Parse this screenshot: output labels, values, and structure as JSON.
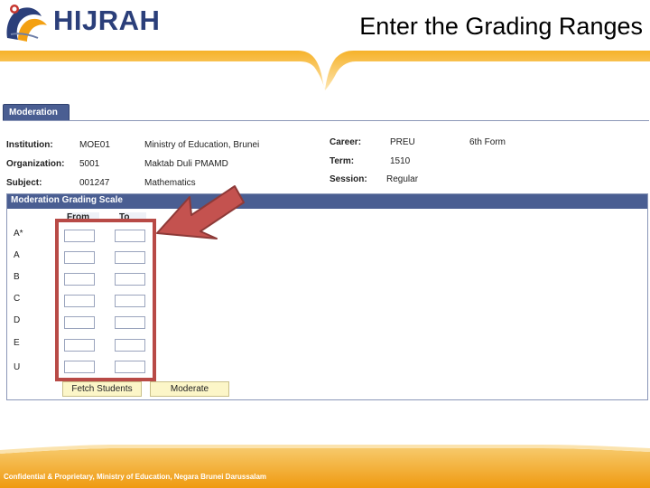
{
  "header": {
    "logo_text": "HIJRAH",
    "logo_tagline": "",
    "slide_title": "Enter the Grading Ranges"
  },
  "tab": {
    "label": "Moderation"
  },
  "info": {
    "institution_label": "Institution:",
    "institution_code": "MOE01",
    "institution_name": "Ministry of Education, Brunei",
    "organization_label": "Organization:",
    "organization_code": "5001",
    "organization_name": "Maktab Duli PMAMD",
    "subject_label": "Subject:",
    "subject_code": "001247",
    "subject_name": "Mathematics",
    "career_label": "Career:",
    "career_code": "PREU",
    "career_name": "6th Form",
    "term_label": "Term:",
    "term_value": "1510",
    "session_label": "Session:",
    "session_value": "Regular"
  },
  "grading": {
    "title": "Moderation Grading Scale",
    "from_label": "From",
    "to_label": "To",
    "grades": [
      "A*",
      "A",
      "B",
      "C",
      "D",
      "E",
      "U"
    ],
    "fetch_button": "Fetch Students",
    "moderate_button": "Moderate"
  },
  "footer": {
    "text": "Confidential & Proprietary, Ministry of Education, Negara Brunei Darussalam"
  },
  "colors": {
    "header_blue": "#4a5e92",
    "accent_orange": "#f3a012",
    "highlight_red": "#b84a46",
    "button_yellow": "#fcf6c8"
  }
}
